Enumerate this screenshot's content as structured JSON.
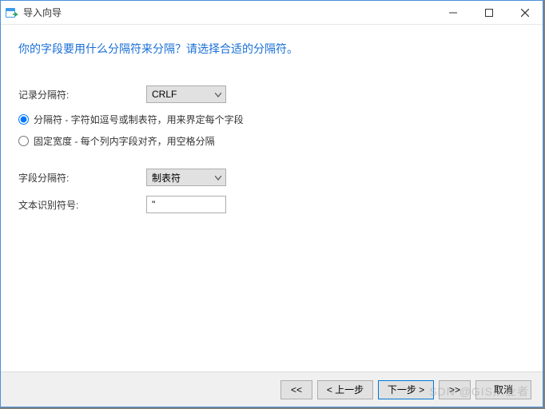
{
  "window": {
    "title": "导入向导"
  },
  "heading": "你的字段要用什么分隔符来分隔？请选择合适的分隔符。",
  "form": {
    "record_separator_label": "记录分隔符:",
    "record_separator_value": "CRLF",
    "radio_delimited": "分隔符 - 字符如逗号或制表符，用来界定每个字段",
    "radio_fixed": "固定宽度 - 每个列内字段对齐，用空格分隔",
    "field_separator_label": "字段分隔符:",
    "field_separator_value": "制表符",
    "text_qualifier_label": "文本识别符号:",
    "text_qualifier_value": "\""
  },
  "footer": {
    "first": "<<",
    "prev": "< 上一步",
    "next": "下一步 >",
    "last": ">>",
    "cancel": "取消"
  },
  "watermark": "SDN @GIS从业者"
}
